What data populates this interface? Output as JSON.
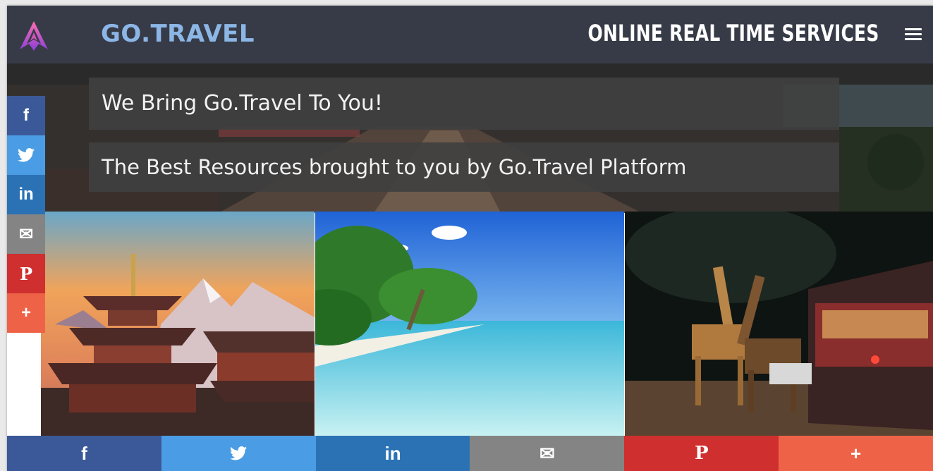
{
  "header": {
    "brand": "GO.TRAVEL",
    "services_title": "ONLINE REAL TIME SERVICES",
    "logo_icon": "go-travel-logo-icon",
    "menu_icon": "hamburger-menu-icon"
  },
  "hero": {
    "headline": "We Bring Go.Travel To You!",
    "subheadline": "The Best Resources brought to you by Go.Travel Platform"
  },
  "share": {
    "items": [
      {
        "label": "f",
        "icon": "facebook-icon",
        "color": "#3b5998"
      },
      {
        "label": "🐦",
        "icon": "twitter-icon",
        "color": "#4a9de4"
      },
      {
        "label": "in",
        "icon": "linkedin-icon",
        "color": "#2b72b5"
      },
      {
        "label": "✉",
        "icon": "email-icon",
        "color": "#848484"
      },
      {
        "label": "P",
        "icon": "pinterest-icon",
        "color": "#cf2f2f"
      },
      {
        "label": "+",
        "icon": "more-share-icon",
        "color": "#ee6347"
      }
    ]
  },
  "gallery": {
    "images": [
      {
        "subject": "pagoda-temple-mountains"
      },
      {
        "subject": "tropical-beach"
      },
      {
        "subject": "night-safari-giraffes"
      }
    ]
  },
  "colors": {
    "header_bg": "#363b47",
    "brand_blue": "#8cb6e6",
    "banner_bg": "#404040"
  }
}
